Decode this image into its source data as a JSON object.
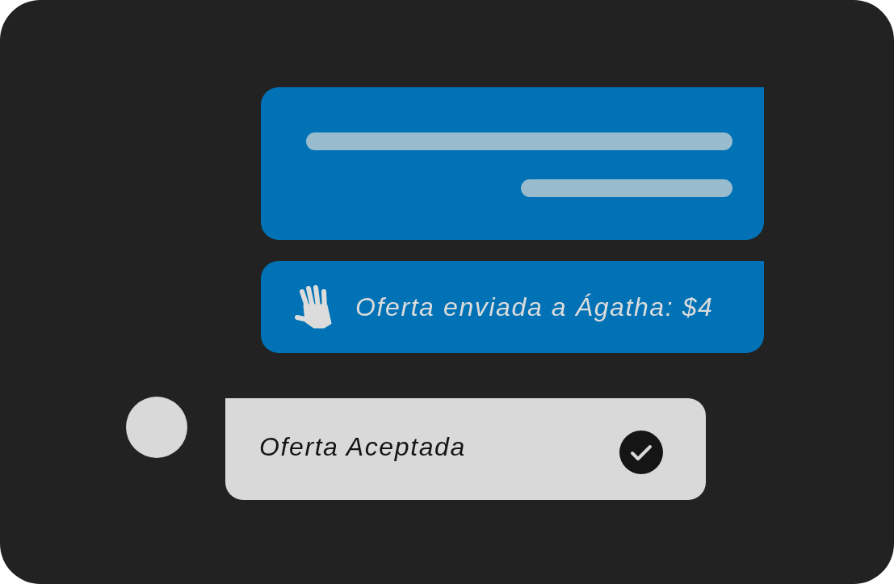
{
  "messages": [
    {
      "kind": "placeholder"
    },
    {
      "kind": "offer",
      "text": "Oferta enviada a Ágatha: $4"
    }
  ],
  "status": {
    "text": "Oferta Aceptada",
    "checked": true
  }
}
